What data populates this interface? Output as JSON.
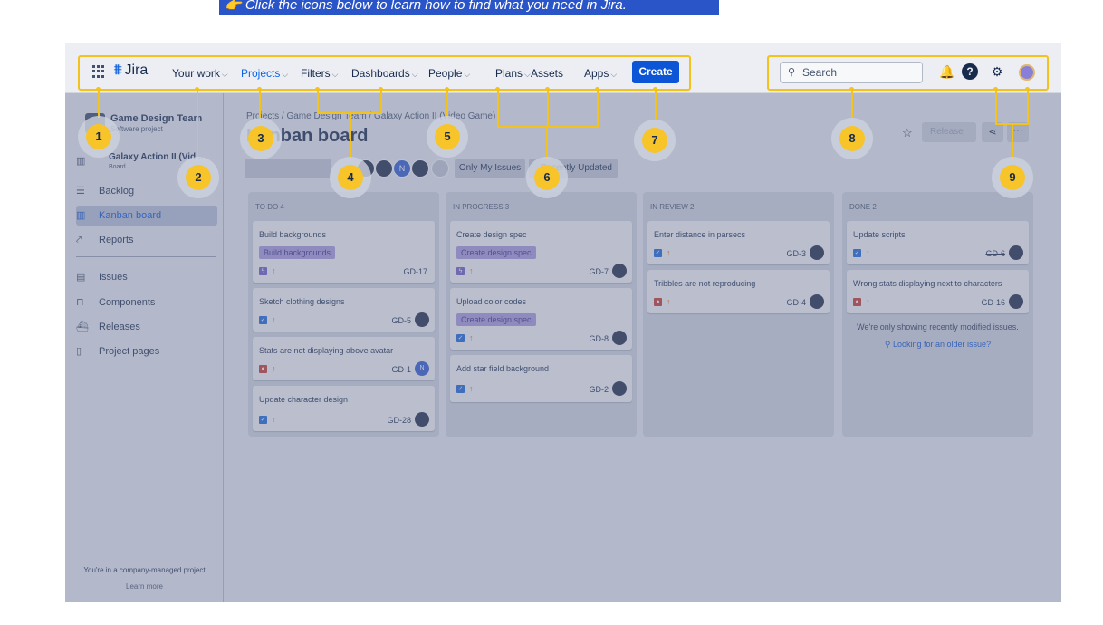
{
  "banner": {
    "text": "👉 Click the icons below to learn how to find what you need in Jira."
  },
  "topnav": {
    "logo": "Jira",
    "items": [
      "Your work",
      "Projects",
      "Filters",
      "Dashboards",
      "People",
      "Plans",
      "Assets",
      "Apps"
    ],
    "create": "Create",
    "search_placeholder": "Search",
    "help_glyph": "?"
  },
  "sidebar": {
    "project_name": "Game Design Team",
    "project_type": "Software project",
    "board_name": "Galaxy Action II (Vid...",
    "board_type": "Board",
    "items": [
      "Backlog",
      "Kanban board",
      "Reports",
      "Issues",
      "Components",
      "Releases",
      "Project pages"
    ],
    "active": "Kanban board",
    "footer_note": "You're in a company-managed project",
    "footer_link": "Learn more"
  },
  "header": {
    "breadcrumb": "Projects  /  Game Design Team  /  Galaxy Action II (Video Game)",
    "title": "Kanban board",
    "release": "Release",
    "more": "···"
  },
  "filters": {
    "only_mine": "Only My Issues",
    "recent": "Recently Updated",
    "avatar_letter": "N"
  },
  "columns": [
    {
      "header": "TO DO 4",
      "cards": [
        {
          "title": "Build backgrounds",
          "label": "Build backgrounds",
          "type": "epic",
          "key": "GD-17",
          "avatar": ""
        },
        {
          "title": "Sketch clothing designs",
          "label": "",
          "type": "task",
          "key": "GD-5",
          "avatar": ""
        },
        {
          "title": "Stats are not displaying above avatar",
          "label": "",
          "type": "bug",
          "key": "GD-1",
          "avatar": "N"
        },
        {
          "title": "Update character design",
          "label": "",
          "type": "task",
          "key": "GD-28",
          "avatar": ""
        }
      ]
    },
    {
      "header": "IN PROGRESS 3",
      "cards": [
        {
          "title": "Create design spec",
          "label": "Create design spec",
          "type": "epic",
          "key": "GD-7",
          "avatar": ""
        },
        {
          "title": "Upload color codes",
          "label": "Create design spec",
          "type": "task",
          "key": "GD-8",
          "avatar": ""
        },
        {
          "title": "Add star field background",
          "label": "",
          "type": "task",
          "key": "GD-2",
          "avatar": ""
        }
      ]
    },
    {
      "header": "IN REVIEW 2",
      "cards": [
        {
          "title": "Enter distance in parsecs",
          "label": "",
          "type": "task",
          "key": "GD-3",
          "avatar": ""
        },
        {
          "title": "Tribbles are not reproducing",
          "label": "",
          "type": "bug",
          "key": "GD-4",
          "avatar": ""
        }
      ]
    },
    {
      "header": "DONE 2",
      "cards": [
        {
          "title": "Update scripts",
          "label": "",
          "type": "task",
          "key": "GD-6",
          "avatar": ""
        },
        {
          "title": "Wrong stats displaying next to characters",
          "label": "",
          "type": "bug",
          "key": "GD-16",
          "avatar": ""
        }
      ],
      "note": "We're only showing recently modified issues.",
      "link": "Looking for an older issue?"
    }
  ],
  "markers": [
    "1",
    "2",
    "3",
    "4",
    "5",
    "6",
    "7",
    "8",
    "9"
  ],
  "colors": {
    "accent": "#f3c21b",
    "brand": "#0c55d6",
    "banner": "#2a55c9"
  }
}
